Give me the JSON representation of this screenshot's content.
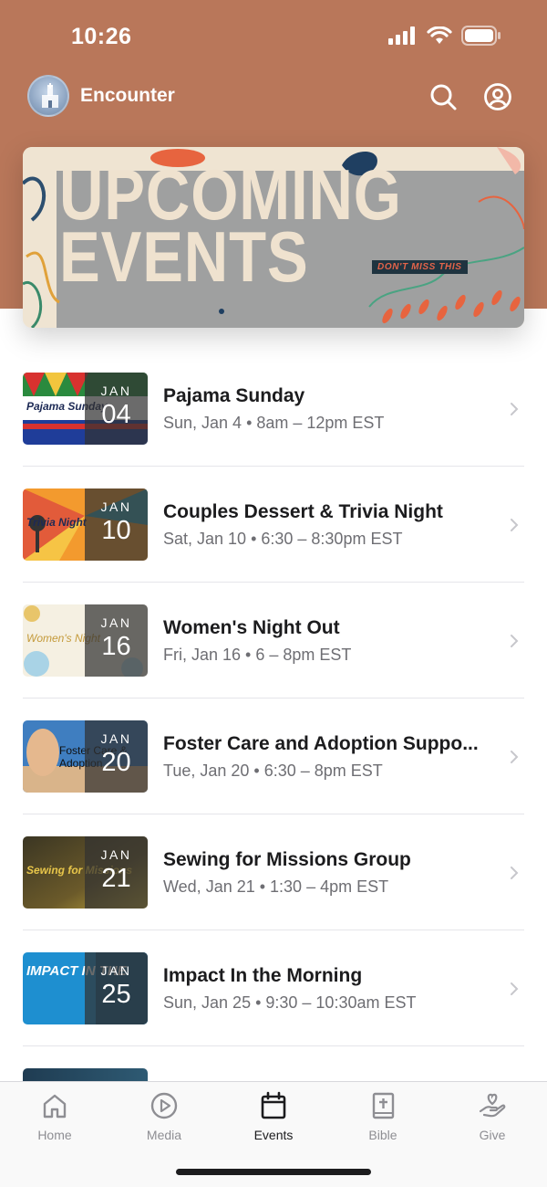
{
  "status_bar": {
    "time": "10:26"
  },
  "app": {
    "title": "Encounter"
  },
  "banner": {
    "line1": "UPCOMING",
    "line2": "EVENTS",
    "tag": "DON'T MISS THIS"
  },
  "events": [
    {
      "title": "Pajama Sunday",
      "subtitle": "Sun, Jan 4 • 8am – 12pm EST",
      "month": "JAN",
      "day": "04",
      "thumb_text": "Pajama Sunday"
    },
    {
      "title": "Couples Dessert & Trivia Night",
      "subtitle": "Sat, Jan 10 • 6:30 – 8:30pm EST",
      "month": "JAN",
      "day": "10",
      "thumb_text": "Trivia Night"
    },
    {
      "title": "Women's Night Out",
      "subtitle": "Fri, Jan 16 • 6 – 8pm EST",
      "month": "JAN",
      "day": "16",
      "thumb_text": "Women's Night"
    },
    {
      "title": "Foster Care and Adoption Suppo...",
      "subtitle": "Tue, Jan 20 • 6:30 – 8pm EST",
      "month": "JAN",
      "day": "20",
      "thumb_text": "Foster Care & Adoption"
    },
    {
      "title": "Sewing for Missions Group",
      "subtitle": "Wed, Jan 21 • 1:30 – 4pm EST",
      "month": "JAN",
      "day": "21",
      "thumb_text": "Sewing for Missions"
    },
    {
      "title": "Impact In the Morning",
      "subtitle": "Sun, Jan 25 • 9:30 – 10:30am EST",
      "month": "JAN",
      "day": "25",
      "thumb_text": "IMPACT IN THE"
    }
  ],
  "tabs": [
    {
      "label": "Home",
      "icon": "home-icon"
    },
    {
      "label": "Media",
      "icon": "play-icon"
    },
    {
      "label": "Events",
      "icon": "calendar-icon"
    },
    {
      "label": "Bible",
      "icon": "bible-icon"
    },
    {
      "label": "Give",
      "icon": "give-icon"
    }
  ],
  "active_tab": "Events",
  "colors": {
    "header": "#b9775a",
    "badge": "#323232",
    "tab_active": "#1c1c1e",
    "tab_inactive": "#8e8e93"
  }
}
